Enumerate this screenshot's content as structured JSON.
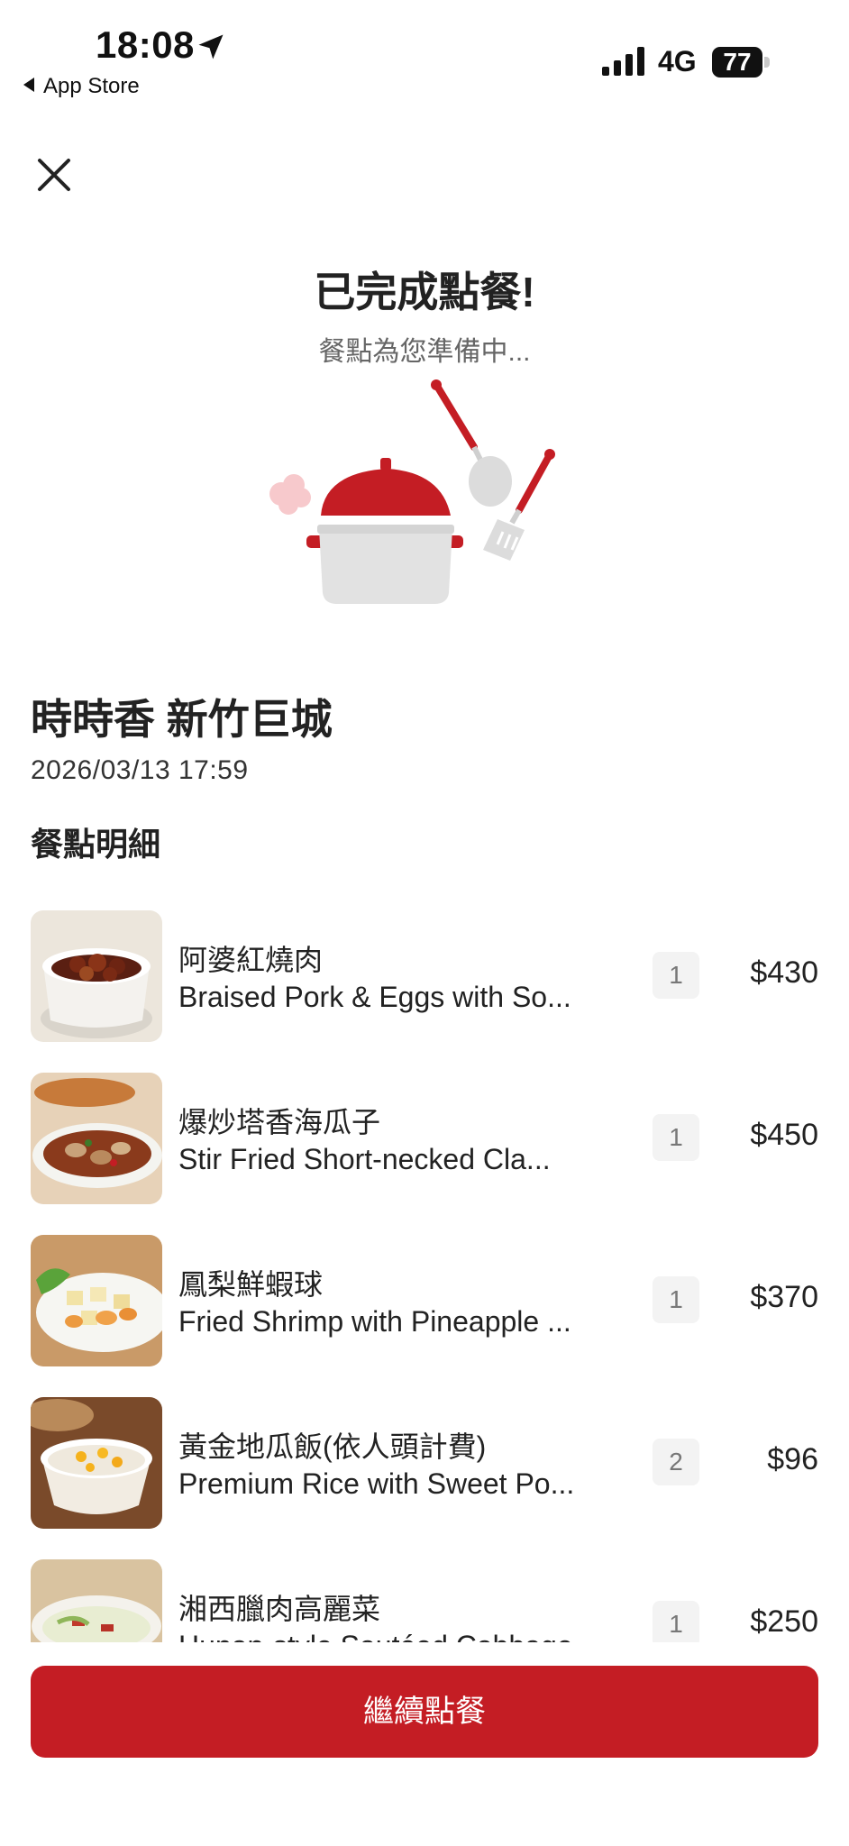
{
  "status_bar": {
    "time": "18:08",
    "back_app": "App Store",
    "network": "4G",
    "battery": "77"
  },
  "header": {
    "title": "已完成點餐!",
    "subtitle": "餐點為您準備中..."
  },
  "order": {
    "store": "時時香 新竹巨城",
    "datetime": "2026/03/13 17:59",
    "section_title": "餐點明細",
    "items": [
      {
        "name_zh": "阿婆紅燒肉",
        "name_en": "Braised Pork & Eggs with So...",
        "qty": "1",
        "price": "$430"
      },
      {
        "name_zh": "爆炒塔香海瓜子",
        "name_en": "Stir Fried Short-necked Cla...",
        "qty": "1",
        "price": "$450"
      },
      {
        "name_zh": "鳳梨鮮蝦球",
        "name_en": "Fried Shrimp with Pineapple ...",
        "qty": "1",
        "price": "$370"
      },
      {
        "name_zh": "黃金地瓜飯(依人頭計費)",
        "name_en": "Premium Rice with Sweet Po...",
        "qty": "2",
        "price": "$96"
      },
      {
        "name_zh": "湘西臘肉高麗菜",
        "name_en": "Hunan-style Sautéed Cabbage",
        "qty": "1",
        "price": "$250"
      }
    ]
  },
  "cta": {
    "label": "繼續點餐"
  },
  "colors": {
    "accent": "#c41d24"
  }
}
